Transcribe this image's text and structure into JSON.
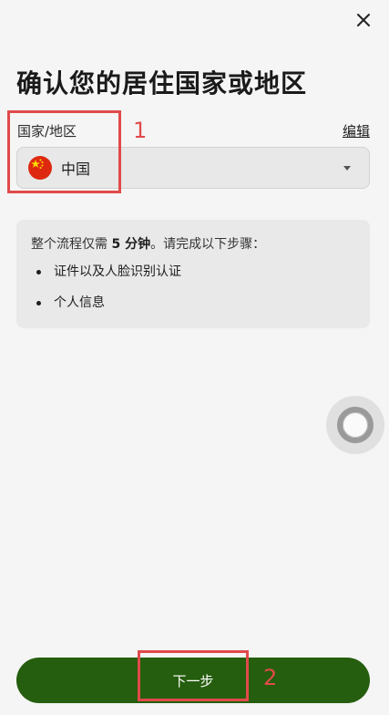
{
  "header": {
    "close_icon": "close-icon",
    "title": "确认您的居住国家或地区"
  },
  "country_field": {
    "label": "国家/地区",
    "edit_label": "编辑",
    "selected_value": "中国",
    "flag_icon": "china-flag-icon",
    "dropdown_icon": "caret-down-icon"
  },
  "info": {
    "intro_prefix": "整个流程仅需 ",
    "intro_bold": "5 分钟",
    "intro_suffix": "。请完成以下步骤：",
    "steps": [
      "证件以及人脸识别认证",
      "个人信息"
    ]
  },
  "floating_assist": {
    "icon": "assistive-touch-icon"
  },
  "footer": {
    "next_label": "下一步"
  },
  "annotations": [
    {
      "number": "1"
    },
    {
      "number": "2"
    }
  ],
  "colors": {
    "background": "#f5f5f5",
    "primary_button": "#255e0e",
    "annotation": "#e14a4a",
    "flag_red": "#de2910",
    "flag_star": "#ffde00"
  }
}
